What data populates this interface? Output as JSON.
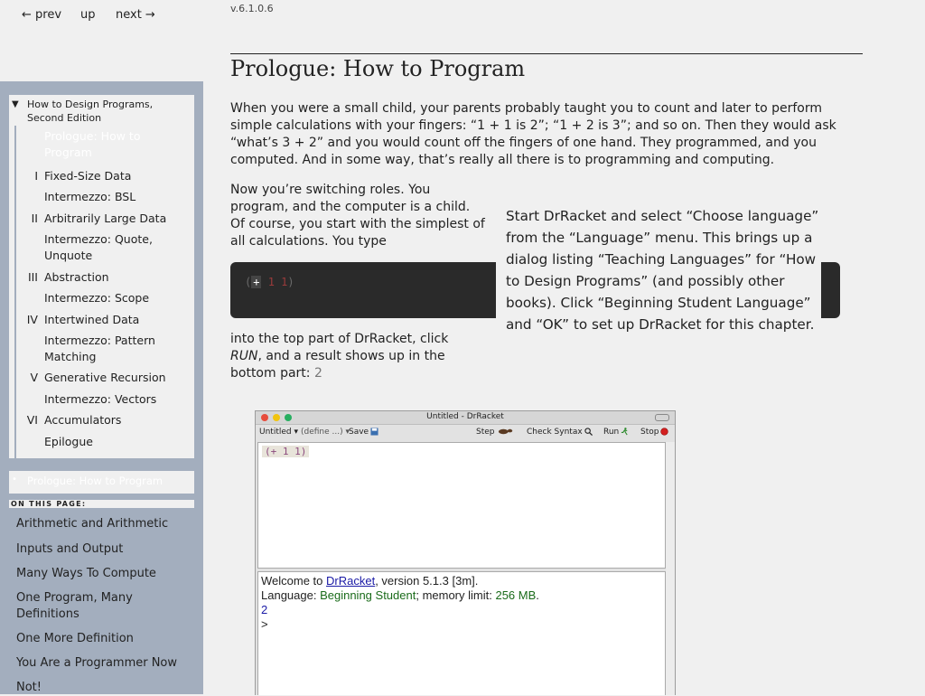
{
  "nav": {
    "prev": "← prev",
    "up": "up",
    "next": "next →"
  },
  "toc": {
    "book_arrow": "▼",
    "book_title": "How to Design Programs, Second Edition",
    "items": [
      {
        "num": "",
        "label": "Prologue: How to Program",
        "current": true
      },
      {
        "num": "I",
        "label": "Fixed-Size Data"
      },
      {
        "num": "",
        "label": "Intermezzo: BSL"
      },
      {
        "num": "II",
        "label": "Arbitrarily Large Data"
      },
      {
        "num": "",
        "label": "Intermezzo: Quote, Unquote"
      },
      {
        "num": "III",
        "label": "Abstraction"
      },
      {
        "num": "",
        "label": "Intermezzo: Scope"
      },
      {
        "num": "IV",
        "label": "Intertwined Data"
      },
      {
        "num": "",
        "label": "Intermezzo: Pattern Matching"
      },
      {
        "num": "V",
        "label": "Generative Recursion"
      },
      {
        "num": "",
        "label": "Intermezzo: Vectors"
      },
      {
        "num": "VI",
        "label": "Accumulators"
      },
      {
        "num": "",
        "label": "Epilogue"
      }
    ]
  },
  "onpage": {
    "current_bullet": "•",
    "current": "Prologue: How to Program",
    "heading": "ON THIS PAGE:",
    "links": [
      "Arithmetic and Arithmetic",
      "Inputs and Output",
      "Many Ways To Compute",
      "One Program, Many Definitions",
      "One More Definition",
      "You Are a Programmer Now",
      "Not!"
    ]
  },
  "main": {
    "version": "v.6.1.0.6",
    "title": "Prologue: How to Program",
    "para1": "When you were a small child, your parents probably taught you to count and later to perform simple calculations with your fingers: “1 + 1 is 2”; “1 + 2 is 3”; and so on. Then they would ask “what’s 3 + 2” and you would count off the fingers of one hand. They programmed, and you computed. And in some way, that’s really all there is to programming and computing.",
    "para2": "Now you’re switching roles. You program, and the computer is a child. Of course, you start with the simplest of all calculations. You type",
    "code": {
      "open": "(",
      "op": "+",
      "args": " 1 1",
      "close": ")"
    },
    "note": "Start DrRacket and select “Choose language” from the “Language” menu. This brings up a dialog listing “Teaching Languages” for “How to Design Programs” (and possibly other books). Click “Beginning Student Language” and “OK” to set up DrRacket for this chapter.",
    "para3_a": "into the top part of DrRacket, click ",
    "para3_em": "RUN",
    "para3_b": ", and a result shows up in the bottom part: ",
    "para3_result": "2"
  },
  "drracket": {
    "title": "Untitled - DrRacket",
    "toolbar": {
      "untitled": "Untitled ▾",
      "define": "(define ...) ▾",
      "save": "Save",
      "step": "Step",
      "check_syntax": "Check Syntax",
      "run": "Run",
      "stop": "Stop"
    },
    "definitions_code": "(+ 1 1)",
    "interactions": {
      "welcome_a": "Welcome to ",
      "welcome_link": "DrRacket",
      "welcome_b": ", version 5.1.3 [3m].",
      "lang_a": "Language: ",
      "lang_name": "Beginning Student",
      "lang_b": "; memory limit: ",
      "lang_mem": "256 MB",
      "lang_c": ".",
      "result": "2",
      "prompt": ">"
    }
  }
}
